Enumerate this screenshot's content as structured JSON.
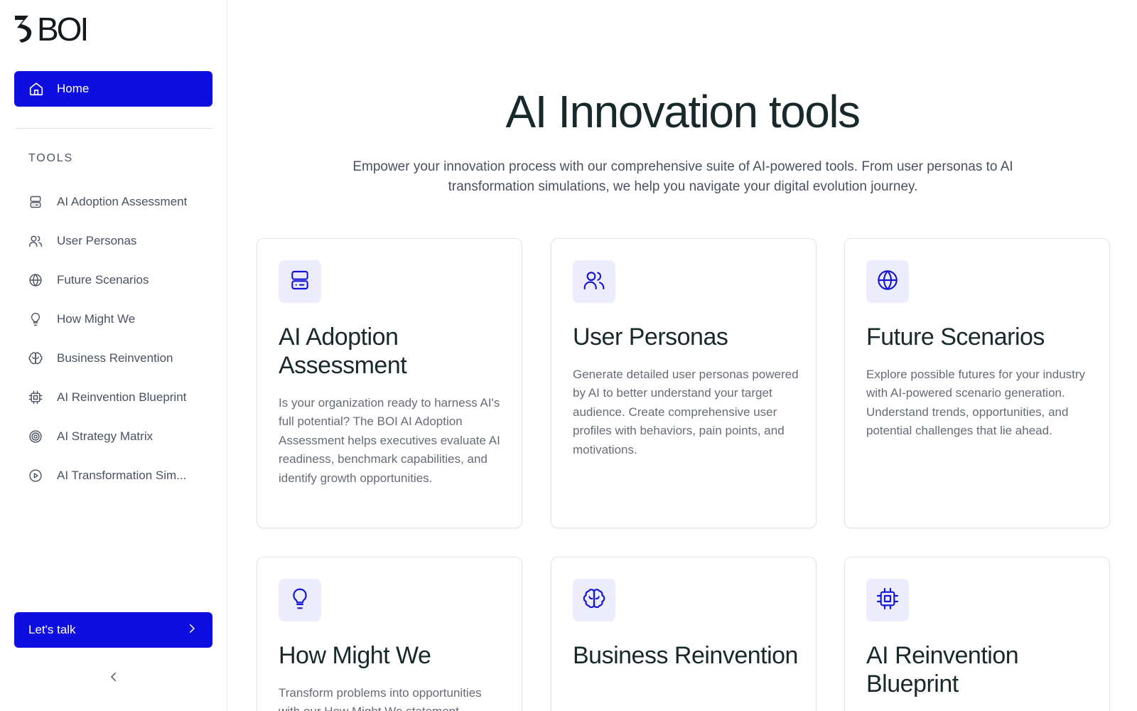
{
  "logo": {
    "text": "BOI"
  },
  "sidebar": {
    "home": {
      "label": "Home",
      "icon": "home-icon"
    },
    "tools_heading": "TOOLS",
    "items": [
      {
        "label": "AI Adoption Assessment",
        "icon": "server-icon"
      },
      {
        "label": "User Personas",
        "icon": "users-icon"
      },
      {
        "label": "Future Scenarios",
        "icon": "globe-icon"
      },
      {
        "label": "How Might We",
        "icon": "lightbulb-icon"
      },
      {
        "label": "Business Reinvention",
        "icon": "brain-icon"
      },
      {
        "label": "AI Reinvention Blueprint",
        "icon": "cpu-icon"
      },
      {
        "label": "AI Strategy Matrix",
        "icon": "target-icon"
      },
      {
        "label": "AI Transformation Sim...",
        "icon": "play-circle-icon"
      }
    ],
    "cta": {
      "label": "Let's talk",
      "icon": "chevron-right-icon"
    },
    "collapse_icon": "chevron-left-icon"
  },
  "main": {
    "title": "AI Innovation tools",
    "subtitle": "Empower your innovation process with our comprehensive suite of AI-powered tools. From user personas to AI transformation simulations, we help you navigate your digital evolution journey.",
    "cards": [
      {
        "title": "AI Adoption Assessment",
        "description": "Is your organization ready to harness AI's full potential? The BOI AI Adoption Assessment helps executives evaluate AI readiness, benchmark capabilities, and identify growth opportunities.",
        "icon": "server-icon"
      },
      {
        "title": "User Personas",
        "description": "Generate detailed user personas powered by AI to better understand your target audience. Create comprehensive user profiles with behaviors, pain points, and motivations.",
        "icon": "users-icon"
      },
      {
        "title": "Future Scenarios",
        "description": "Explore possible futures for your industry with AI-powered scenario generation. Understand trends, opportunities, and potential challenges that lie ahead.",
        "icon": "globe-icon"
      },
      {
        "title": "How Might We",
        "description": "Transform problems into opportunities with our How Might We statement",
        "icon": "lightbulb-icon"
      },
      {
        "title": "Business Reinvention",
        "description": "",
        "icon": "brain-icon"
      },
      {
        "title": "AI Reinvention Blueprint",
        "description": "",
        "icon": "cpu-icon"
      }
    ]
  },
  "colors": {
    "primary": "#0e0ee0",
    "icon_bg": "#ececfd",
    "icon_fg": "#1414d6",
    "heading": "#19282a",
    "body_text": "#666b75"
  }
}
